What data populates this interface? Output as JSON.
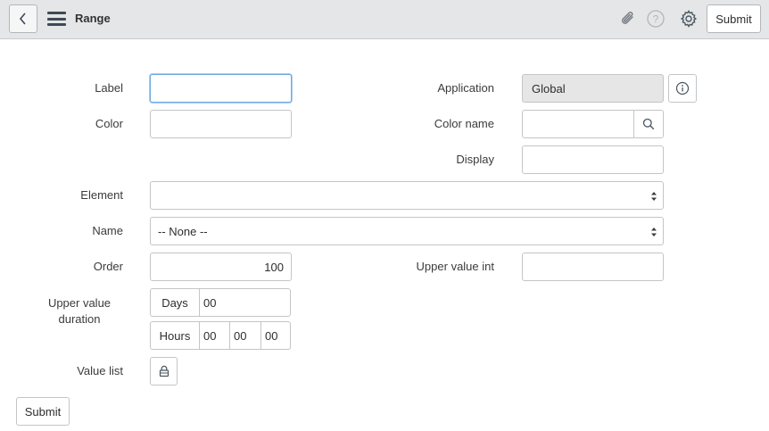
{
  "header": {
    "title": "Range",
    "submit_label": "Submit",
    "icons": [
      "back-icon",
      "menu-icon",
      "paperclip-icon",
      "help-icon",
      "gear-icon"
    ]
  },
  "form": {
    "label": {
      "label": "Label",
      "value": ""
    },
    "application": {
      "label": "Application",
      "value": "Global"
    },
    "color": {
      "label": "Color",
      "value": ""
    },
    "color_name": {
      "label": "Color name",
      "value": ""
    },
    "display": {
      "label": "Display",
      "value": ""
    },
    "element": {
      "label": "Element",
      "value": ""
    },
    "name": {
      "label": "Name",
      "value": "-- None --"
    },
    "order": {
      "label": "Order",
      "value": "100"
    },
    "upper_value_int": {
      "label": "Upper value int",
      "value": ""
    },
    "upper_value_duration": {
      "label_line1": "Upper value",
      "label_line2": "duration",
      "days_label": "Days",
      "days": "00",
      "hours_label": "Hours",
      "hours": "00",
      "minutes": "00",
      "seconds": "00"
    },
    "value_list": {
      "label": "Value list"
    }
  },
  "footer": {
    "submit_label": "Submit"
  }
}
